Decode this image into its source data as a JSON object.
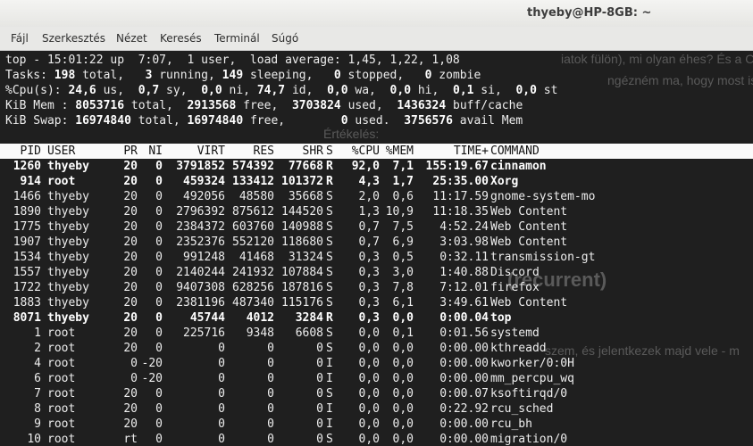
{
  "window": {
    "title": "thyeby@HP-8GB: ~"
  },
  "menu": [
    "Fájl",
    "Szerkesztés",
    "Nézet",
    "Keresés",
    "Terminál",
    "Súgó"
  ],
  "background_text": [
    "iatok fülön), mi olyan éhes? És a Cinnamon",
    "ngézném ma, hogy most is ugya",
    "Értékelés:",
    "(recurrent)",
    "szem, és jelentkezek majd vele - m"
  ],
  "top": {
    "line1": "top - 15:01:22 up  7:07,  1 user,  load average: 1,45, 1,22, 1,08",
    "line2_parts": [
      "Tasks: ",
      "198",
      " total,   ",
      "3",
      " running, ",
      "149",
      " sleeping,   ",
      "0",
      " stopped,   ",
      "0",
      " zombie"
    ],
    "line3_parts": [
      "%Cpu(s): ",
      "24,6",
      " us,  ",
      "0,7",
      " sy,  ",
      "0,0",
      " ni, ",
      "74,7",
      " id,  ",
      "0,0",
      " wa,  ",
      "0,0",
      " hi,  ",
      "0,1",
      " si,  ",
      "0,0",
      " st"
    ],
    "line4_parts": [
      "KiB Mem : ",
      "8053716",
      " total,  ",
      "2913568",
      " free,  ",
      "3703824",
      " used,  ",
      "1436324",
      " buff/cache"
    ],
    "line5_parts": [
      "KiB Swap: ",
      "16974840",
      " total, ",
      "16974840",
      " free,        ",
      "0",
      " used.  ",
      "3756576",
      " avail Mem"
    ]
  },
  "columns": [
    "PID",
    "USER",
    "PR",
    "NI",
    "VIRT",
    "RES",
    "SHR",
    "S",
    "%CPU",
    "%MEM",
    "TIME+",
    "COMMAND"
  ],
  "processes": [
    {
      "pid": "1260",
      "user": "thyeby",
      "pr": "20",
      "ni": "0",
      "virt": "3791852",
      "res": "574392",
      "shr": "77668",
      "s": "R",
      "cpu": "92,0",
      "mem": "7,1",
      "time": "155:19.67",
      "cmd": "cinnamon",
      "bold": true
    },
    {
      "pid": "914",
      "user": "root",
      "pr": "20",
      "ni": "0",
      "virt": "459324",
      "res": "133412",
      "shr": "101372",
      "s": "R",
      "cpu": "4,3",
      "mem": "1,7",
      "time": "25:35.00",
      "cmd": "Xorg",
      "bold": true
    },
    {
      "pid": "1466",
      "user": "thyeby",
      "pr": "20",
      "ni": "0",
      "virt": "492056",
      "res": "48580",
      "shr": "35668",
      "s": "S",
      "cpu": "2,0",
      "mem": "0,6",
      "time": "11:17.59",
      "cmd": "gnome-system-mo",
      "bold": false
    },
    {
      "pid": "1890",
      "user": "thyeby",
      "pr": "20",
      "ni": "0",
      "virt": "2796392",
      "res": "875612",
      "shr": "144520",
      "s": "S",
      "cpu": "1,3",
      "mem": "10,9",
      "time": "11:18.35",
      "cmd": "Web Content",
      "bold": false
    },
    {
      "pid": "1775",
      "user": "thyeby",
      "pr": "20",
      "ni": "0",
      "virt": "2384372",
      "res": "603760",
      "shr": "140988",
      "s": "S",
      "cpu": "0,7",
      "mem": "7,5",
      "time": "4:52.24",
      "cmd": "Web Content",
      "bold": false
    },
    {
      "pid": "1907",
      "user": "thyeby",
      "pr": "20",
      "ni": "0",
      "virt": "2352376",
      "res": "552120",
      "shr": "118680",
      "s": "S",
      "cpu": "0,7",
      "mem": "6,9",
      "time": "3:03.98",
      "cmd": "Web Content",
      "bold": false
    },
    {
      "pid": "1534",
      "user": "thyeby",
      "pr": "20",
      "ni": "0",
      "virt": "991248",
      "res": "41468",
      "shr": "31324",
      "s": "S",
      "cpu": "0,3",
      "mem": "0,5",
      "time": "0:32.11",
      "cmd": "transmission-gt",
      "bold": false
    },
    {
      "pid": "1557",
      "user": "thyeby",
      "pr": "20",
      "ni": "0",
      "virt": "2140244",
      "res": "241932",
      "shr": "107884",
      "s": "S",
      "cpu": "0,3",
      "mem": "3,0",
      "time": "1:40.88",
      "cmd": "Discord",
      "bold": false
    },
    {
      "pid": "1722",
      "user": "thyeby",
      "pr": "20",
      "ni": "0",
      "virt": "9407308",
      "res": "628256",
      "shr": "187816",
      "s": "S",
      "cpu": "0,3",
      "mem": "7,8",
      "time": "7:12.01",
      "cmd": "firefox",
      "bold": false
    },
    {
      "pid": "1883",
      "user": "thyeby",
      "pr": "20",
      "ni": "0",
      "virt": "2381196",
      "res": "487340",
      "shr": "115176",
      "s": "S",
      "cpu": "0,3",
      "mem": "6,1",
      "time": "3:49.61",
      "cmd": "Web Content",
      "bold": false
    },
    {
      "pid": "8071",
      "user": "thyeby",
      "pr": "20",
      "ni": "0",
      "virt": "45744",
      "res": "4012",
      "shr": "3284",
      "s": "R",
      "cpu": "0,3",
      "mem": "0,0",
      "time": "0:00.04",
      "cmd": "top",
      "bold": true
    },
    {
      "pid": "1",
      "user": "root",
      "pr": "20",
      "ni": "0",
      "virt": "225716",
      "res": "9348",
      "shr": "6608",
      "s": "S",
      "cpu": "0,0",
      "mem": "0,1",
      "time": "0:01.56",
      "cmd": "systemd",
      "bold": false
    },
    {
      "pid": "2",
      "user": "root",
      "pr": "20",
      "ni": "0",
      "virt": "0",
      "res": "0",
      "shr": "0",
      "s": "S",
      "cpu": "0,0",
      "mem": "0,0",
      "time": "0:00.00",
      "cmd": "kthreadd",
      "bold": false
    },
    {
      "pid": "4",
      "user": "root",
      "pr": "0",
      "ni": "-20",
      "virt": "0",
      "res": "0",
      "shr": "0",
      "s": "I",
      "cpu": "0,0",
      "mem": "0,0",
      "time": "0:00.00",
      "cmd": "kworker/0:0H",
      "bold": false
    },
    {
      "pid": "6",
      "user": "root",
      "pr": "0",
      "ni": "-20",
      "virt": "0",
      "res": "0",
      "shr": "0",
      "s": "I",
      "cpu": "0,0",
      "mem": "0,0",
      "time": "0:00.00",
      "cmd": "mm_percpu_wq",
      "bold": false
    },
    {
      "pid": "7",
      "user": "root",
      "pr": "20",
      "ni": "0",
      "virt": "0",
      "res": "0",
      "shr": "0",
      "s": "S",
      "cpu": "0,0",
      "mem": "0,0",
      "time": "0:00.07",
      "cmd": "ksoftirqd/0",
      "bold": false
    },
    {
      "pid": "8",
      "user": "root",
      "pr": "20",
      "ni": "0",
      "virt": "0",
      "res": "0",
      "shr": "0",
      "s": "I",
      "cpu": "0,0",
      "mem": "0,0",
      "time": "0:22.92",
      "cmd": "rcu_sched",
      "bold": false
    },
    {
      "pid": "9",
      "user": "root",
      "pr": "20",
      "ni": "0",
      "virt": "0",
      "res": "0",
      "shr": "0",
      "s": "I",
      "cpu": "0,0",
      "mem": "0,0",
      "time": "0:00.00",
      "cmd": "rcu_bh",
      "bold": false
    },
    {
      "pid": "10",
      "user": "root",
      "pr": "rt",
      "ni": "0",
      "virt": "0",
      "res": "0",
      "shr": "0",
      "s": "S",
      "cpu": "0,0",
      "mem": "0,0",
      "time": "0:00.00",
      "cmd": "migration/0",
      "bold": false
    }
  ]
}
